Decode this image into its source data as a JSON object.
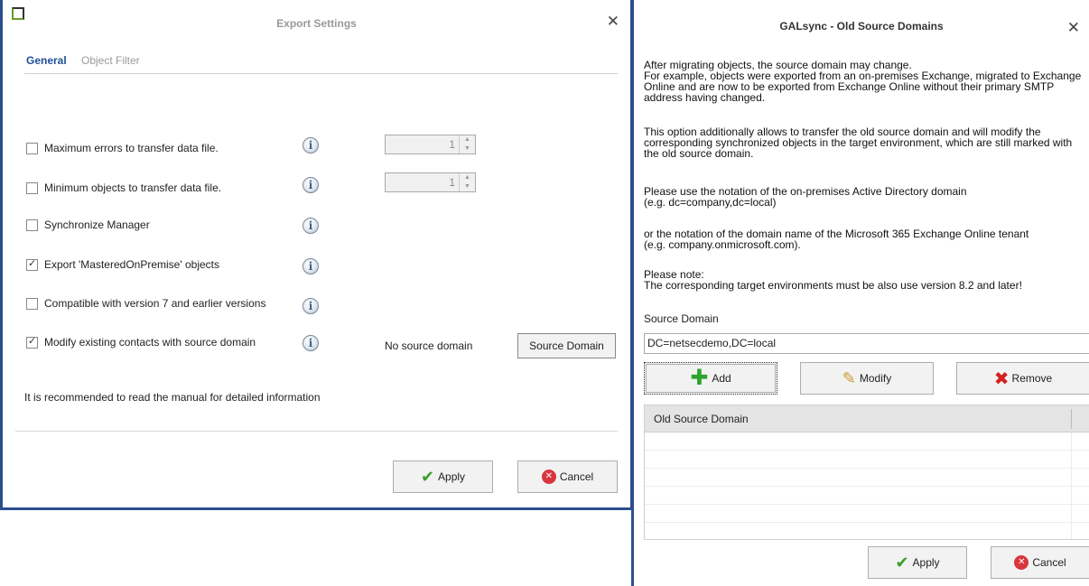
{
  "export_settings": {
    "title": "Export Settings",
    "tabs": [
      {
        "label": "General",
        "active": true
      },
      {
        "label": "Object Filter",
        "active": false
      }
    ],
    "options": [
      {
        "label": "Maximum errors to transfer data file.",
        "checked": false,
        "spin_value": "1"
      },
      {
        "label": "Minimum objects to transfer data file.",
        "checked": false,
        "spin_value": "1"
      },
      {
        "label": "Synchronize Manager",
        "checked": false
      },
      {
        "label": "Export 'MasteredOnPremise' objects",
        "checked": true
      },
      {
        "label": "Compatible with version 7 and earlier versions",
        "checked": false
      },
      {
        "label": "Modify existing contacts with source domain",
        "checked": true
      }
    ],
    "info_glyph": "i",
    "no_source_domain": "No source domain",
    "source_domain_button": "Source Domain",
    "recommendation": "It is recommended to read the manual for detailed information",
    "apply_label": "Apply",
    "cancel_label": "Cancel"
  },
  "old_source_domains": {
    "title": "GALsync - Old Source Domains",
    "description": [
      "After migrating objects, the source domain may change.",
      "For example, objects were exported from an on-premises Exchange, migrated to Exchange Online and are now to be exported from Exchange Online without their primary SMTP address having changed.",
      "This option additionally allows to transfer the old source domain and will modify the corresponding synchronized objects in the target environment, which are still marked with the old source domain.",
      "Please use the notation of the on-premises Active Directory domain",
      "(e.g. dc=company,dc=local)",
      "or the notation of the domain name of the Microsoft 365 Exchange Online tenant",
      "(e.g. company.onmicrosoft.com).",
      "Please note:",
      "The corresponding target environments must be also use version 8.2 and later!"
    ],
    "source_domain_label": "Source Domain",
    "source_domain_value": "DC=netsecdemo,DC=local",
    "add_label": "Add",
    "modify_label": "Modify",
    "remove_label": "Remove",
    "grid_header": "Old Source Domain",
    "apply_label": "Apply",
    "cancel_label": "Cancel"
  },
  "colors": {
    "accent": "#2a4f8f",
    "active_tab": "#1f4e99",
    "apply_check": "#3aa02a",
    "cancel_red": "#d9363e"
  }
}
